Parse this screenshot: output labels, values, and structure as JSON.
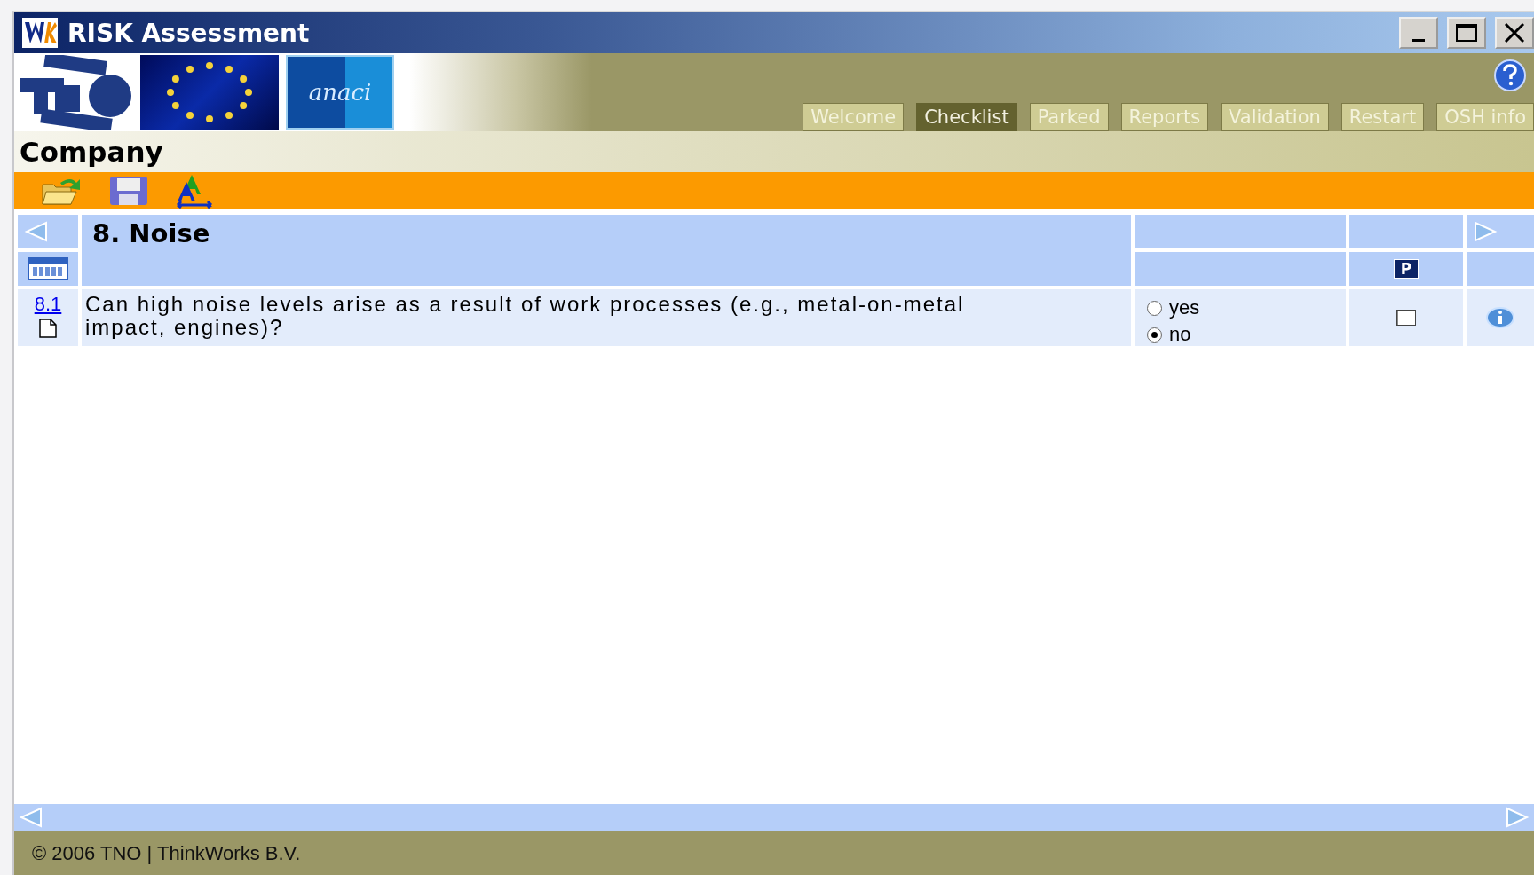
{
  "window": {
    "title": "RISK Assessment"
  },
  "partner_logo": {
    "text": "anaci"
  },
  "tabs": [
    {
      "label": "Welcome",
      "selected": false
    },
    {
      "label": "Checklist",
      "selected": true
    },
    {
      "label": "Parked",
      "selected": false
    },
    {
      "label": "Reports",
      "selected": false
    },
    {
      "label": "Validation",
      "selected": false
    },
    {
      "label": "Restart",
      "selected": false
    },
    {
      "label": "OSH info",
      "selected": false
    }
  ],
  "company": "Company",
  "section": {
    "title": "8. Noise",
    "park_column": "P"
  },
  "questions": [
    {
      "number": "8.1",
      "text": "Can high noise levels arise as a result of work processes (e.g., metal-on-metal impact, engines)?",
      "options": [
        {
          "label": "yes",
          "selected": false
        },
        {
          "label": "no",
          "selected": true
        }
      ],
      "parked": false
    }
  ],
  "footer": "© 2006 TNO | ThinkWorks B.V."
}
